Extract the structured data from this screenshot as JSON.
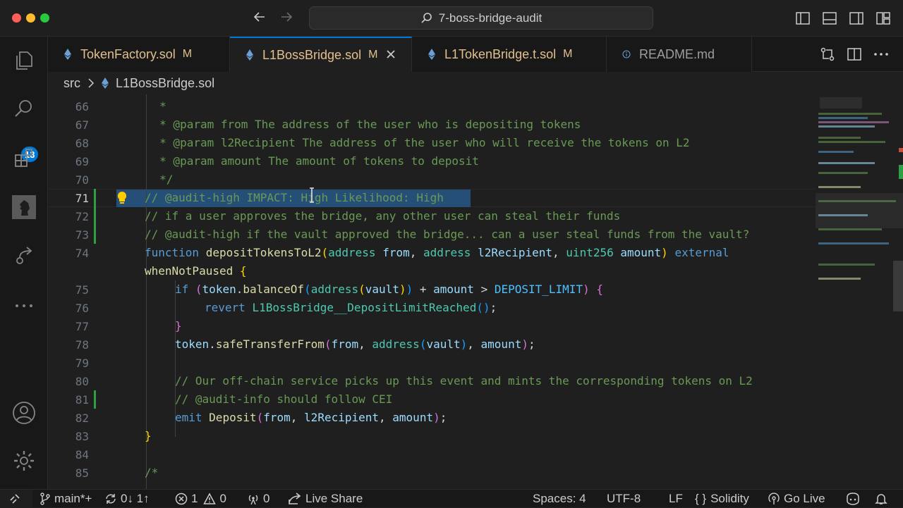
{
  "window": {
    "search_text": "7-boss-bridge-audit",
    "back_icon": "arrow-left-icon",
    "forward_icon": "arrow-right-icon"
  },
  "activity_bar": {
    "search_badge": "13",
    "items": [
      "explorer-icon",
      "search-icon",
      "extensions-icon",
      "avatar-icon",
      "remote-icon",
      "more-icon",
      "account-icon",
      "settings-gear-icon"
    ]
  },
  "tabs": [
    {
      "name": "TokenFactory.sol",
      "status": "M",
      "icon": "ethereum-icon"
    },
    {
      "name": "L1BossBridge.sol",
      "status": "M",
      "icon": "ethereum-icon",
      "active": true
    },
    {
      "name": "L1TokenBridge.t.sol",
      "status": "M",
      "icon": "ethereum-icon"
    },
    {
      "name": "README.md",
      "status": "",
      "icon": "info-icon"
    }
  ],
  "breadcrumb": {
    "folder": "src",
    "file": "L1BossBridge.sol"
  },
  "editor": {
    "line_numbers": [
      "66",
      "67",
      "68",
      "69",
      "70",
      "71",
      "72",
      "73",
      "74",
      "",
      "75",
      "76",
      "77",
      "78",
      "79",
      "80",
      "81",
      "82",
      "83",
      "84",
      "85"
    ],
    "current_line": "71",
    "lines": {
      "l66": "     *",
      "l67": "     * @param from The address of the user who is depositing tokens",
      "l68": "     * @param l2Recipient The address of the user who will receive the tokens on L2",
      "l69": "     * @param amount The amount of tokens to deposit",
      "l70": "     */",
      "l71": "// @audit-high IMPACT: High Likelihood: High",
      "l72": "// if a user approves the bridge, any other user can steal their funds",
      "l73": "// @audit-high if the vault approved the bridge... can a user steal funds from the vault?",
      "l74_kw": "function",
      "l74_fn": "depositTokensToL2",
      "l74_p1": "address",
      "l74_v1": "from",
      "l74_p2": "address",
      "l74_v2": "l2Recipient",
      "l74_p3": "uint256",
      "l74_v3": "amount",
      "l74_ext": "external",
      "l74b_mod": "whenNotPaused",
      "l75_if": "if",
      "l75_tok": "token",
      "l75_bal": "balanceOf",
      "l75_addr": "address",
      "l75_vault": "vault",
      "l75_amt": "amount",
      "l75_const": "DEPOSIT_LIMIT",
      "l76_rev": "revert",
      "l76_err": "L1BossBridge__DepositLimitReached",
      "l78_tok": "token",
      "l78_fn": "safeTransferFrom",
      "l78_from": "from",
      "l78_addr": "address",
      "l78_vault": "vault",
      "l78_amt": "amount",
      "l80": "// Our off-chain service picks up this event and mints the corresponding tokens on L2",
      "l81": "// @audit-info should follow CEI",
      "l82_emit": "emit",
      "l82_ev": "Deposit",
      "l82_from": "from",
      "l82_rec": "l2Recipient",
      "l82_amt": "amount",
      "l85": "/*"
    }
  },
  "status_bar": {
    "branch": "main*+",
    "sync": "0↓ 1↑",
    "errors": "1",
    "warnings": "0",
    "ports": "0",
    "live_share": "Live Share",
    "spaces": "Spaces: 4",
    "encoding": "UTF-8",
    "eol": "LF",
    "language": "Solidity",
    "go_live": "Go Live"
  },
  "colors": {
    "accent": "#0078d4",
    "modified": "#e2c08d",
    "comment": "#6a9955",
    "keyword": "#569cd6",
    "function": "#dcdcaa"
  }
}
